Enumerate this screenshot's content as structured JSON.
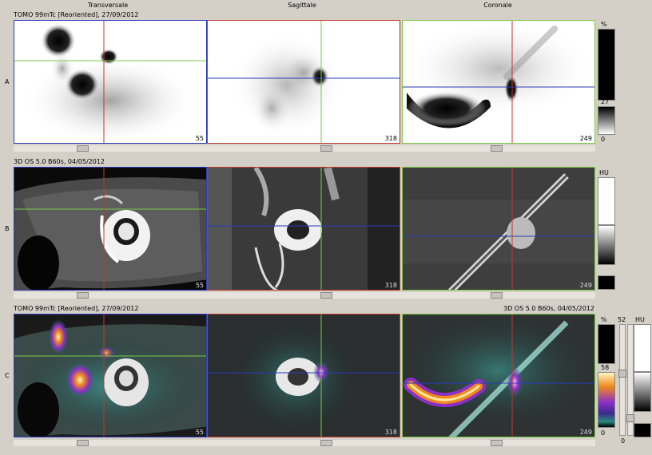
{
  "columns": {
    "c1": "Transversale",
    "c2": "Sagittale",
    "c3": "Coronale"
  },
  "rows": {
    "a": "A",
    "b": "B",
    "c": "C"
  },
  "series": {
    "a": "TOMO 99mTc [Reoriented], 27/09/2012",
    "b": "3D  OS  5.0  B60s, 04/05/2012",
    "c_left": "TOMO 99mTc [Reoriented], 27/09/2012",
    "c_right": "3D  OS  5.0  B60s, 04/05/2012"
  },
  "slices": {
    "a1": "55",
    "a2": "318",
    "a3": "249",
    "b1": "55",
    "b2": "318",
    "b3": "249",
    "c1": "55",
    "c2": "318",
    "c3": "249"
  },
  "lut": {
    "a_unit": "%",
    "a_value": "27",
    "a_min": "0",
    "b_unit": "HU",
    "c_unit": "%",
    "c_value": "58",
    "c_min": "0",
    "c_ct_unit": "HU",
    "c_ct_top": "52",
    "c_ct_min": "0"
  },
  "colors": {
    "red": "#c0392b",
    "green": "#7ac943",
    "blue": "#2a3bb8",
    "orange": "#f08a1c"
  }
}
